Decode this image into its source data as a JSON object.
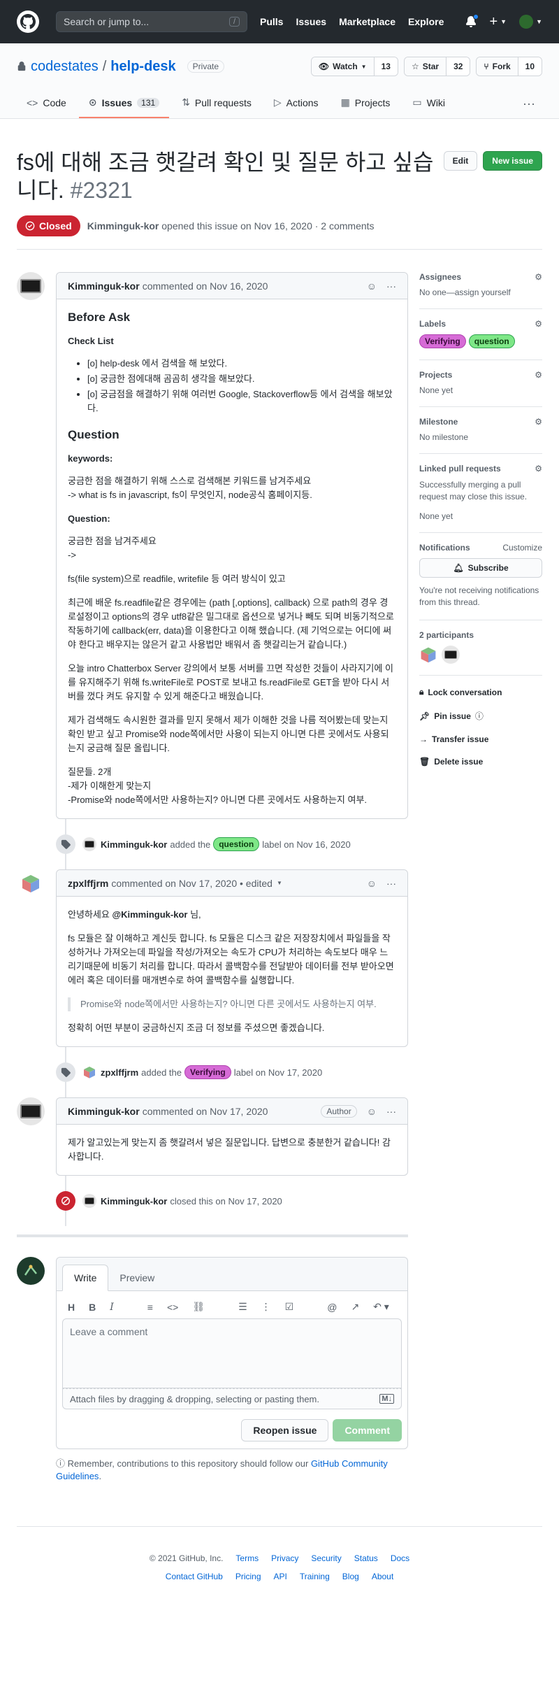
{
  "header": {
    "search_placeholder": "Search or jump to...",
    "search_key": "/",
    "nav": [
      "Pulls",
      "Issues",
      "Marketplace",
      "Explore"
    ]
  },
  "repo": {
    "owner": "codestates",
    "name": "help-desk",
    "visibility": "Private",
    "watch": {
      "label": "Watch",
      "count": "13"
    },
    "star": {
      "label": "Star",
      "count": "32"
    },
    "fork": {
      "label": "Fork",
      "count": "10"
    },
    "tabs": [
      {
        "label": "Code"
      },
      {
        "label": "Issues",
        "count": "131"
      },
      {
        "label": "Pull requests"
      },
      {
        "label": "Actions"
      },
      {
        "label": "Projects"
      },
      {
        "label": "Wiki"
      }
    ]
  },
  "issue": {
    "title": "fs에 대해 조금 햇갈려 확인 및 질문 하고 싶습니다.",
    "number": "#2321",
    "edit_label": "Edit",
    "new_issue_label": "New issue",
    "state": "Closed",
    "author": "Kimminguk-kor",
    "meta": "opened this issue on Nov 16, 2020 · 2 comments"
  },
  "comments": [
    {
      "author": "Kimminguk-kor",
      "meta": "commented on Nov 16, 2020",
      "h_before": "Before Ask",
      "h_checklist": "Check List",
      "checklist": [
        "[o] help-desk 에서 검색을 해 보았다.",
        "[o] 궁금한 점에대해 곰곰히 생각을 해보았다.",
        "[o] 궁금점을 해결하기 위해 여러번 Google, Stackoverflow등 에서 검색을 해보았다."
      ],
      "h_question": "Question",
      "h_keywords": "keywords:",
      "keywords_1": "궁금한 점을 해결하기 위해 스스로 검색해본 키워드를 남겨주세요",
      "keywords_2": "-> what is fs in javascript, fs이 무엇인지, node공식 홈페이지등.",
      "h_question2": "Question:",
      "q_1": "궁금한 점을 남겨주세요",
      "q_2": "->",
      "p1": "fs(file system)으로 readfile, writefile 등 여러 방식이 있고",
      "p2": "최근에 배운 fs.readfile같은 경우에는 (path [,options], callback) 으로 path의 경우 경로설정이고 options의 경우 utf8같은 밀그대로 옵션으로 넣거나 빼도 되며 비동기적으로 작동하기에 callback(err, data)을 이용한다고 이해 했습니다. (제 기억으로는 어디에 써야 한다고 배우지는 않은거 같고 사용법만 배워서 좀 햇갈리는거 같습니다.)",
      "p3": "오늘 intro Chatterbox Server 강의에서 보통 서버를 끄면 작성한 것들이 사라지기에 이를 유지해주기 위해 fs.writeFile로 POST로 보내고 fs.readFile로 GET을 받아 다시 서버를 껐다 켜도 유지할 수 있게 해준다고 배웠습니다.",
      "p4": "제가 검색해도 속시원한 결과를 믿지 못해서 제가 이해한 것을 나름 적어봤는데 맞는지 확인 받고 싶고 Promise와 node쪽에서만 사용이 되는지 아니면 다른 곳에서도 사용되는지 궁금해 질문 올립니다.",
      "q_title": "질문들. 2개",
      "q_a": "-제가 이해한게 맞는지",
      "q_b": "-Promise와 node쪽에서만 사용하는지? 아니면 다른 곳에서도 사용하는지 여부."
    },
    {
      "author": "zpxlffjrm",
      "meta": "commented on Nov 17, 2020 • edited",
      "greeting_pre": "안녕하세요",
      "mention": "@Kimminguk-kor",
      "greeting_post": "님,",
      "p1": "fs 모듈은 잘 이해하고 계신듯 합니다. fs 모듈은 디스크 같은 저장장치에서 파일들을 작성하거나 가져오는데 파일을 작성/가져오는 속도가 CPU가 처리하는 속도보다 매우 느리기때문에 비동기 처리를 합니다. 따라서 콜백함수를 전달받아 데이터를 전부 받아오면 에러 혹은 데이터를 매개변수로 하여 콜백함수를 실행합니다.",
      "quote": "Promise와 node쪽에서만 사용하는지? 아니면 다른 곳에서도 사용하는지 여부.",
      "p2": "정확히 어떤 부분이 궁금하신지 조금 더 정보를 주셨으면 좋겠습니다."
    },
    {
      "author": "Kimminguk-kor",
      "meta": "commented on Nov 17, 2020",
      "badge": "Author",
      "p1": "제가 알고있는게 맞는지 좀 햇갈려서 넣은 질문입니다. 답변으로 충분한거 같습니다! 감사합니다."
    }
  ],
  "events": [
    {
      "author": "Kimminguk-kor",
      "pre": "added the",
      "label": "question",
      "post": "label on Nov 16, 2020"
    },
    {
      "author": "zpxlffjrm",
      "pre": "added the",
      "label": "Verifying",
      "post": "label on Nov 17, 2020"
    },
    {
      "author": "Kimminguk-kor",
      "text": "closed this on Nov 17, 2020"
    }
  ],
  "editor": {
    "tab_write": "Write",
    "tab_preview": "Preview",
    "placeholder": "Leave a comment",
    "attach": "Attach files by dragging & dropping, selecting or pasting them.",
    "reopen": "Reopen issue",
    "comment": "Comment",
    "guide_pre": "Remember, contributions to this repository should follow our",
    "guide_link": "GitHub Community Guidelines",
    "guide_post": "."
  },
  "sidebar": {
    "assignees": {
      "title": "Assignees",
      "value": "No one—assign yourself"
    },
    "labels": {
      "title": "Labels",
      "items": [
        "Verifying",
        "question"
      ]
    },
    "projects": {
      "title": "Projects",
      "value": "None yet"
    },
    "milestone": {
      "title": "Milestone",
      "value": "No milestone"
    },
    "linked": {
      "title": "Linked pull requests",
      "desc": "Successfully merging a pull request may close this issue.",
      "value": "None yet"
    },
    "notifications": {
      "title": "Notifications",
      "customize": "Customize",
      "subscribe": "Subscribe",
      "desc": "You're not receiving notifications from this thread."
    },
    "participants": {
      "title": "2 participants"
    },
    "actions": [
      "Lock conversation",
      "Pin issue",
      "Transfer issue",
      "Delete issue"
    ]
  },
  "footer": {
    "copyright": "© 2021 GitHub, Inc.",
    "row1": [
      "Terms",
      "Privacy",
      "Security",
      "Status",
      "Docs"
    ],
    "row2": [
      "Contact GitHub",
      "Pricing",
      "API",
      "Training",
      "Blog",
      "About"
    ]
  },
  "colors": {
    "closed": "#cb2431",
    "question": "#7ee787",
    "verifying": "#d66bd6",
    "primary": "#2ea44f",
    "link": "#0366d6"
  }
}
